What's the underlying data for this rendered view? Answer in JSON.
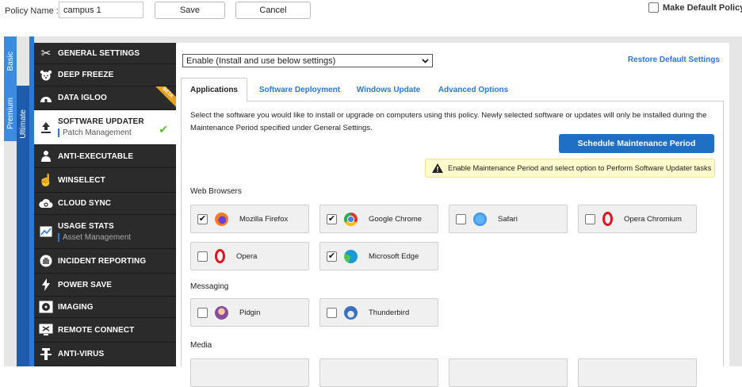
{
  "header": {
    "policy_name_label": "Policy Name :",
    "policy_name_value": "campus 1",
    "save_label": "Save",
    "cancel_label": "Cancel",
    "make_default_label": "Make Default Policy",
    "make_default_checked": false
  },
  "tiers": {
    "basic": "Basic",
    "premium": "Premium",
    "ultimate": "Ultimate"
  },
  "nav": {
    "items": [
      {
        "label": "GENERAL SETTINGS",
        "icon": "tools-icon"
      },
      {
        "label": "DEEP FREEZE",
        "icon": "bear-icon"
      },
      {
        "label": "DATA IGLOO",
        "icon": "igloo-icon",
        "badge": "BETA"
      },
      {
        "label": "SOFTWARE UPDATER",
        "sub": "Patch Management",
        "icon": "upload-icon",
        "active": true,
        "status": "✔"
      },
      {
        "label": "ANTI-EXECUTABLE",
        "icon": "shield-person-icon"
      },
      {
        "label": "WINSELECT",
        "icon": "cursor-hand-icon"
      },
      {
        "label": "CLOUD SYNC",
        "icon": "cloud-sync-icon"
      },
      {
        "label": "USAGE STATS",
        "sub": "Asset Management",
        "icon": "chart-icon"
      },
      {
        "label": "INCIDENT REPORTING",
        "icon": "hand-icon"
      },
      {
        "label": "POWER SAVE",
        "icon": "lightning-icon"
      },
      {
        "label": "IMAGING",
        "icon": "disc-icon"
      },
      {
        "label": "REMOTE CONNECT",
        "icon": "remote-icon"
      },
      {
        "label": "ANTI-VIRUS",
        "icon": "antivirus-icon"
      }
    ]
  },
  "panel": {
    "mode_select": "Enable (Install and use below settings)",
    "restore_label": "Restore Default Settings",
    "tabs": [
      "Applications",
      "Software Deployment",
      "Windows Update",
      "Advanced Options"
    ],
    "description": "Select the software you would like to install or upgrade on computers using this policy. Newly selected software or updates will only be installed during the Maintenance Period specified under General Settings.",
    "schedule_button": "Schedule Maintenance Period",
    "warning": "Enable Maintenance Period and select option to Perform Software Updater tasks",
    "categories": [
      {
        "name": "Web Browsers",
        "items": [
          {
            "name": "Mozilla Firefox",
            "checked": true,
            "icon": "firefox-icon",
            "color": "#ff6b1a"
          },
          {
            "name": "Google Chrome",
            "checked": true,
            "icon": "chrome-icon",
            "color": "#e2352b"
          },
          {
            "name": "Safari",
            "checked": false,
            "icon": "safari-icon",
            "color": "#2e8fe8"
          },
          {
            "name": "Opera Chromium",
            "checked": false,
            "icon": "opera-icon",
            "color": "#e0141e"
          },
          {
            "name": "Opera",
            "checked": false,
            "icon": "opera-icon",
            "color": "#e0141e"
          },
          {
            "name": "Microsoft Edge",
            "checked": true,
            "icon": "edge-icon",
            "color": "#1c9ad6"
          }
        ]
      },
      {
        "name": "Messaging",
        "items": [
          {
            "name": "Pidgin",
            "checked": false,
            "icon": "pidgin-icon",
            "color": "#8a4b9c"
          },
          {
            "name": "Thunderbird",
            "checked": false,
            "icon": "thunderbird-icon",
            "color": "#3a6fc2"
          }
        ]
      },
      {
        "name": "Media",
        "items": []
      }
    ]
  }
}
